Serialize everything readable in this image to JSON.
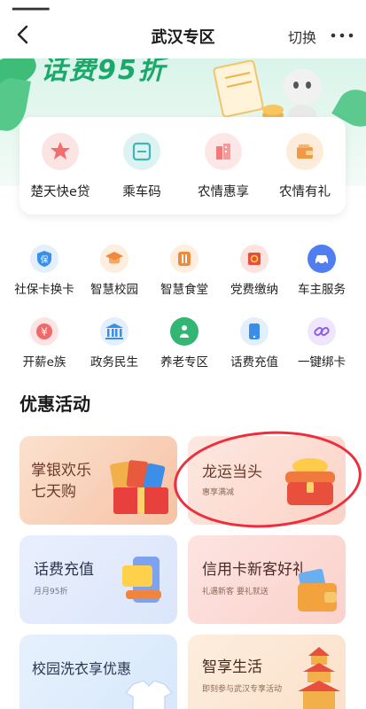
{
  "nav": {
    "title": "武汉专区",
    "switch_label": "切换",
    "more_label": "···"
  },
  "banner": {
    "slogan": "话费95折"
  },
  "quick_services": [
    {
      "label": "楚天快e贷",
      "icon": "medal-icon",
      "color": "#f26d6d"
    },
    {
      "label": "乘车码",
      "icon": "qr-scan-icon",
      "color": "#3fb6b8"
    },
    {
      "label": "农情惠享",
      "icon": "building-icon",
      "color": "#f27a7a"
    },
    {
      "label": "农情有礼",
      "icon": "wallet-icon",
      "color": "#f29a43"
    }
  ],
  "grid_services": [
    {
      "label": "社保卡换卡",
      "icon": "shield-icon",
      "color": "#3a8ee8"
    },
    {
      "label": "智慧校园",
      "icon": "graduation-cap-icon",
      "color": "#f0883e"
    },
    {
      "label": "智慧食堂",
      "icon": "utensils-icon",
      "color": "#f0883e"
    },
    {
      "label": "党费缴纳",
      "icon": "party-flag-icon",
      "color": "#e84d3d"
    },
    {
      "label": "车主服务",
      "icon": "car-icon",
      "color": "#4f7ef0"
    },
    {
      "label": "开薪e族",
      "icon": "yen-icon",
      "color": "#f06a6a"
    },
    {
      "label": "政务民生",
      "icon": "government-icon",
      "color": "#3a8ee8"
    },
    {
      "label": "养老专区",
      "icon": "elder-icon",
      "color": "#33b574"
    },
    {
      "label": "话费充值",
      "icon": "phone-icon",
      "color": "#3a8ee8"
    },
    {
      "label": "一键绑卡",
      "icon": "link-icon",
      "color": "#8a5cf0"
    }
  ],
  "section_title": "优惠活动",
  "promos": [
    {
      "title_line1": "掌银欢乐",
      "title_line2": "七天购",
      "subtitle": "",
      "icon": "gift-box-icon"
    },
    {
      "title_line1": "龙运当头",
      "title_line2": "",
      "subtitle": "惠享满减",
      "icon": "treasure-chest-icon"
    },
    {
      "title_line1": "话费充值",
      "title_line2": "",
      "subtitle": "月月95折",
      "icon": "phone-card-icon"
    },
    {
      "title_line1": "信用卡新客好礼",
      "title_line2": "",
      "subtitle": "礼遇新客 要礼就送",
      "icon": "wallet-cards-icon"
    },
    {
      "title_line1": "校园洗衣享优惠",
      "title_line2": "",
      "subtitle": "",
      "icon": "shirt-icon"
    },
    {
      "title_line1": "智享生活",
      "title_line2": "",
      "subtitle": "即刻参与武汉专享活动",
      "icon": "yellow-crane-tower-icon"
    }
  ],
  "colors": {
    "accent_green": "#1aa86b",
    "annotation_red": "#ef2d3c"
  }
}
